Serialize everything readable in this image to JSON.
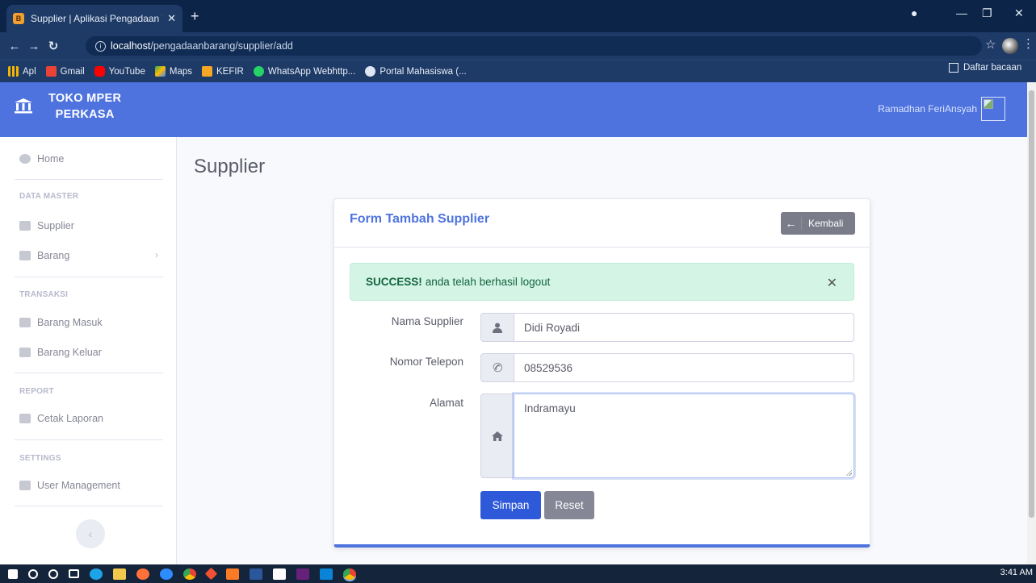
{
  "browser": {
    "tab_title": "Supplier | Aplikasi Pengadaan Tra",
    "url_host": "localhost",
    "url_path": "/pengadaanbarang/supplier/add",
    "bookmarks": [
      "Apl",
      "Gmail",
      "YouTube",
      "Maps",
      "KEFIR",
      "WhatsApp Webhttp...",
      "Portal Mahasiswa (..."
    ],
    "reading_list": "Daftar bacaan"
  },
  "header": {
    "brand_line1": "TOKO MPER",
    "brand_line2": "PERKASA",
    "user_name": "Ramadhan FeriAnsyah"
  },
  "sidebar": {
    "home": "Home",
    "section_master": "DATA MASTER",
    "supplier": "Supplier",
    "barang": "Barang",
    "section_transaksi": "TRANSAKSI",
    "barang_masuk": "Barang Masuk",
    "barang_keluar": "Barang Keluar",
    "section_report": "REPORT",
    "cetak_laporan": "Cetak Laporan",
    "section_settings": "SETTINGS",
    "user_management": "User Management"
  },
  "main": {
    "page_title": "Supplier",
    "card_title": "Form Tambah Supplier",
    "back_label": "Kembali",
    "alert_strong": "SUCCESS!",
    "alert_text": "anda telah berhasil logout",
    "label_nama": "Nama Supplier",
    "value_nama": "Didi Royadi",
    "label_telepon": "Nomor Telepon",
    "value_telepon": "08529536",
    "label_alamat": "Alamat",
    "value_alamat": "Indramayu",
    "save_label": "Simpan",
    "reset_label": "Reset"
  },
  "taskbar": {
    "time": "3:41 AM"
  },
  "colors": {
    "primary": "#4e73df",
    "success_bg": "#d4f4e5",
    "secondary": "#858796"
  }
}
